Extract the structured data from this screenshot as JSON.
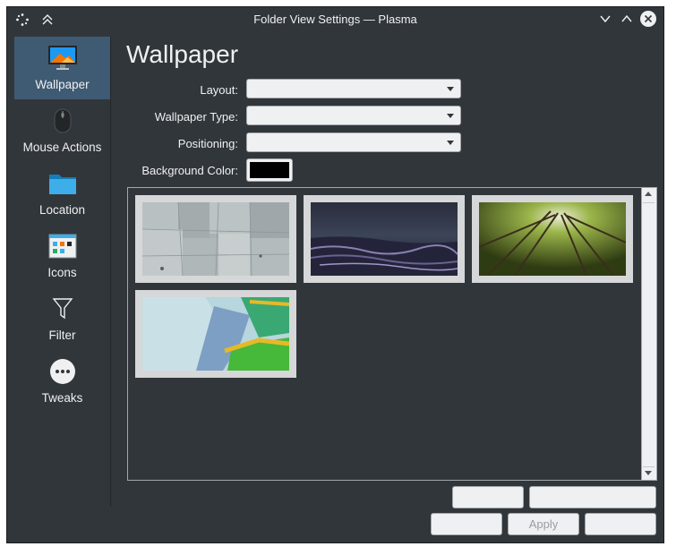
{
  "window": {
    "title": "Folder View Settings — Plasma"
  },
  "sidebar": {
    "items": [
      {
        "label": "Wallpaper",
        "icon": "monitor-icon",
        "active": true
      },
      {
        "label": "Mouse Actions",
        "icon": "mouse-icon",
        "active": false
      },
      {
        "label": "Location",
        "icon": "folder-icon",
        "active": false
      },
      {
        "label": "Icons",
        "icon": "icons-view-icon",
        "active": false
      },
      {
        "label": "Filter",
        "icon": "funnel-icon",
        "active": false
      },
      {
        "label": "Tweaks",
        "icon": "more-icon",
        "active": false
      }
    ]
  },
  "page": {
    "title": "Wallpaper",
    "layout_label": "Layout:",
    "layout_value": "",
    "wallpaper_type_label": "Wallpaper Type:",
    "wallpaper_type_value": "",
    "positioning_label": "Positioning:",
    "positioning_value": "",
    "background_color_label": "Background Color:",
    "background_color": "#000000"
  },
  "wallpapers": [
    {
      "name": "concrete-slabs",
      "icon": "wallpaper-thumbnail"
    },
    {
      "name": "dark-sea-waves",
      "icon": "wallpaper-thumbnail"
    },
    {
      "name": "forest-canopy",
      "icon": "wallpaper-thumbnail"
    },
    {
      "name": "abstract-blue-green",
      "icon": "wallpaper-thumbnail"
    }
  ],
  "buttons": {
    "open": "",
    "get_new": "",
    "ok": "",
    "apply": "Apply",
    "cancel": ""
  },
  "colors": {
    "window_bg": "#31363b",
    "accent": "#3f5a73",
    "text": "#eff0f1"
  }
}
